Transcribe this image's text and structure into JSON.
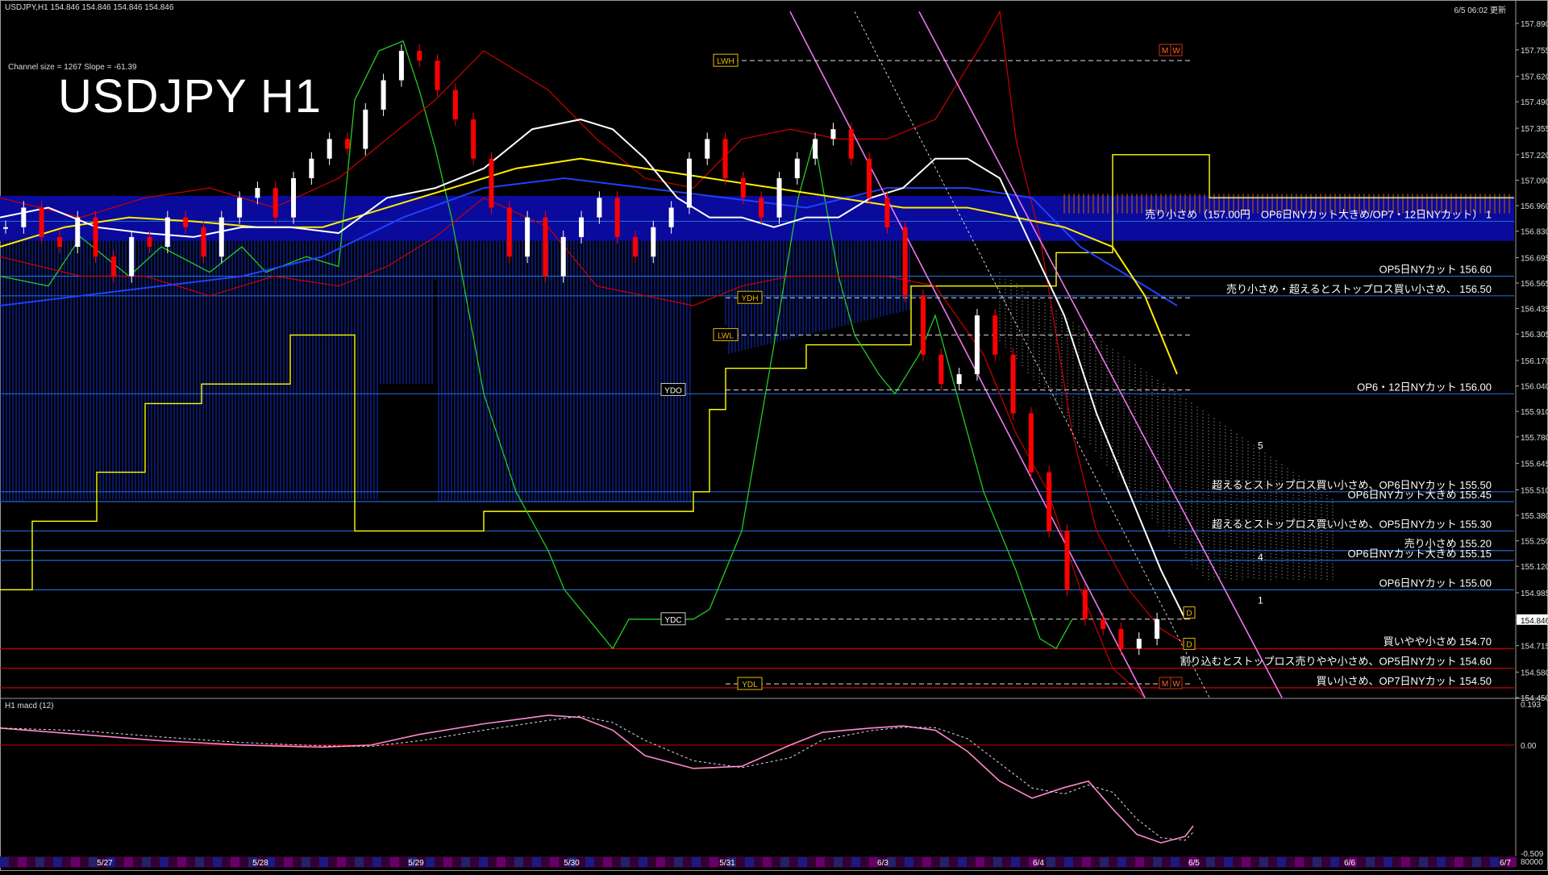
{
  "header": {
    "symbol_line": "USDJPY,H1  154.846 154.846 154.846 154.846",
    "updated": "6/5 06:02 更新",
    "channel_info": "Channel size = 1267 Slope = -61.39",
    "big_title": "USDJPY H1",
    "macd_label": "H1  macd (12)"
  },
  "chart_data": {
    "type": "line",
    "title": "USDJPY H1",
    "price_axis": [
      "157.890",
      "157.755",
      "157.620",
      "157.490",
      "157.355",
      "157.220",
      "157.090",
      "156.960",
      "156.830",
      "156.695",
      "156.565",
      "156.435",
      "156.305",
      "156.170",
      "156.040",
      "155.910",
      "155.780",
      "155.645",
      "155.510",
      "155.380",
      "155.250",
      "155.120",
      "154.985",
      "154.846",
      "154.715",
      "154.580",
      "154.450"
    ],
    "ylim": [
      154.45,
      157.96
    ],
    "current_price": "154.846",
    "date_axis": [
      "5/27",
      "5/28",
      "5/29",
      "5/30",
      "5/31",
      "6/3",
      "6/4",
      "6/5",
      "6/6",
      "6/7"
    ],
    "levels": [
      {
        "label": "売り小さめ（157.00円　OP6日NYカット大きめ/OP7・12日NYカット） 1",
        "price": 156.88
      },
      {
        "label": "OP5日NYカット 156.60",
        "price": 156.6
      },
      {
        "label": "売り小さめ・超えるとストップロス買い小さめ、 156.50",
        "price": 156.5
      },
      {
        "label": "OP6・12日NYカット 156.00",
        "price": 156.0
      },
      {
        "label": "超えるとストップロス買い小さめ、OP6日NYカット 155.50",
        "price": 155.5
      },
      {
        "label": "OP6日NYカット大きめ 155.45",
        "price": 155.45
      },
      {
        "label": "超えるとストップロス買い小さめ、OP5日NYカット 155.30",
        "price": 155.3
      },
      {
        "label": "売り小さめ 155.20",
        "price": 155.2
      },
      {
        "label": "OP6日NYカット大きめ 155.15",
        "price": 155.15
      },
      {
        "label": "OP6日NYカット 155.00",
        "price": 155.0
      },
      {
        "label": "買いやや小さめ 154.70",
        "price": 154.7
      },
      {
        "label": "割り込むとストップロス売りやや小さめ、OP5日NYカット 154.60",
        "price": 154.6
      },
      {
        "label": "買い小さめ、OP7日NYカット 154.50",
        "price": 154.5
      }
    ],
    "markers": [
      {
        "label": "LWH",
        "price": 157.7
      },
      {
        "label": "YDH",
        "price": 156.49
      },
      {
        "label": "LWL",
        "price": 156.3
      },
      {
        "label": "YDO",
        "price": 156.02
      },
      {
        "label": "YDC",
        "price": 154.85
      },
      {
        "label": "YDL",
        "price": 154.52
      }
    ],
    "wave_labels": [
      "5",
      "4",
      "1",
      "D",
      "D",
      "M",
      "W",
      "M",
      "W"
    ],
    "macd_axis": [
      "0.193",
      "0.00",
      "-0.509"
    ],
    "macd_ylim": [
      -0.509,
      0.193
    ],
    "macd_bottom_label": "80000",
    "colors": {
      "background": "#000000",
      "kumo": "#0000ff",
      "kumo_band": "#0a0a9c",
      "level_line": "#2266cc",
      "level_red": "#cc0000",
      "bull_candle": "#ffffff",
      "bear_candle": "#ff0000",
      "ma_white": "#ffffff",
      "ma_yellow": "#ffee00",
      "ma_blue": "#2040ff",
      "chikou_green": "#22cc22",
      "kijun_yellow": "#ffff00",
      "channel_violet": "#ee77ee",
      "macd_pink": "#ff88cc",
      "macd_green": "#33ee33"
    }
  }
}
